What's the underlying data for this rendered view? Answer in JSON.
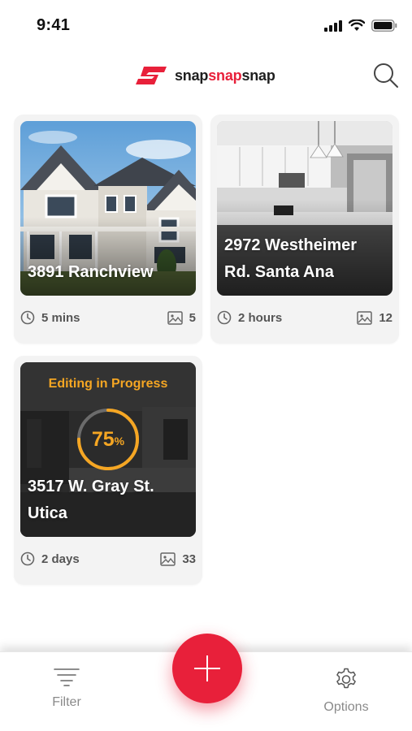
{
  "status_bar": {
    "time": "9:41",
    "icons": [
      "signal-icon",
      "wifi-icon",
      "battery-icon"
    ]
  },
  "header": {
    "logo": {
      "parts": [
        "snap",
        "snap",
        "snap"
      ],
      "colors": {
        "dark": "#1f1f1f",
        "accent": "#e8203a"
      }
    },
    "search_icon": "search-icon"
  },
  "projects": [
    {
      "title": "3891 Ranchview",
      "time": "5 mins",
      "photos": "5"
    },
    {
      "title": "2972 Westheimer Rd. Santa Ana",
      "time": "2 hours",
      "photos": "12"
    },
    {
      "title": "3517 W. Gray St. Utica",
      "time": "2 days",
      "photos": "33",
      "status": "Editing in Progress",
      "progress_value": "75",
      "progress_unit": "%",
      "progress": 0.75
    }
  ],
  "bottom_nav": {
    "filter_label": "Filter",
    "options_label": "Options",
    "add_icon": "plus-icon"
  },
  "colors": {
    "accent": "#e8203a",
    "progress": "#f5a623"
  }
}
